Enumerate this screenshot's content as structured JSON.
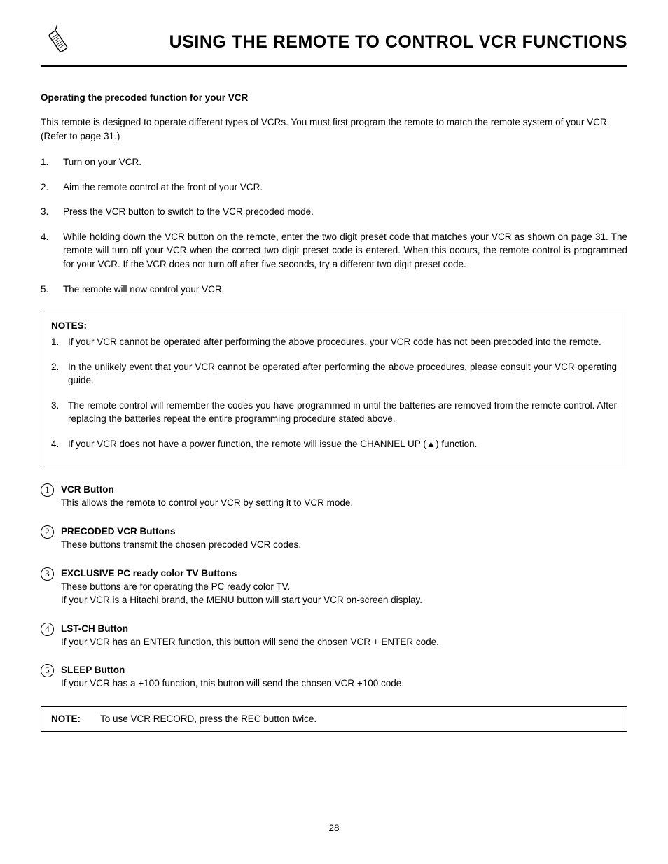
{
  "header": {
    "title": "USING THE REMOTE TO CONTROL VCR FUNCTIONS"
  },
  "section_heading": "Operating the precoded function for your VCR",
  "intro": "This remote is designed to operate different types of VCRs. You must first program the remote to match the remote system of your VCR. (Refer to page 31.)",
  "steps": [
    "Turn on your VCR.",
    "Aim the remote control at the front of your VCR.",
    "Press the VCR button to switch to the VCR precoded mode.",
    "While holding down the VCR button on the remote, enter the two digit preset code that matches your VCR as shown on page 31. The remote will turn off your VCR when the correct two digit preset code is entered. When this occurs, the remote control is programmed for your VCR. If the VCR does not turn off after five seconds, try a different two digit preset code.",
    "The remote will now control your VCR."
  ],
  "notes": {
    "title": "NOTES:",
    "items": [
      "If your VCR cannot be operated after performing the above procedures, your VCR code has not been precoded into the remote.",
      "In the unlikely event that your VCR cannot be operated after performing the above procedures, please consult your VCR operating guide.",
      "The remote control will remember the codes you have programmed in until the batteries are removed from the remote control. After replacing the batteries repeat the entire programming procedure stated above.",
      "If your VCR does not have a power function, the remote will issue the CHANNEL UP (▲) function."
    ]
  },
  "buttons": [
    {
      "num": "1",
      "title": "VCR Button",
      "desc": "This allows the remote to control your VCR by setting it to VCR mode."
    },
    {
      "num": "2",
      "title": "PRECODED VCR Buttons",
      "desc": "These buttons transmit the chosen precoded VCR codes."
    },
    {
      "num": "3",
      "title": "EXCLUSIVE PC ready color TV Buttons",
      "desc": "These buttons are for operating the PC ready color TV.\nIf your VCR is a Hitachi brand, the MENU button will start your VCR on-screen display."
    },
    {
      "num": "4",
      "title": "LST-CH Button",
      "desc": "If your VCR has an  ENTER  function, this button will send the chosen VCR  +  ENTER  code."
    },
    {
      "num": "5",
      "title": "SLEEP Button",
      "desc": "If your VCR has a  +100  function, this button will send the chosen VCR  +100  code."
    }
  ],
  "note2": {
    "label": "NOTE:",
    "text": "To use VCR RECORD, press the REC button twice."
  },
  "page_number": "28"
}
